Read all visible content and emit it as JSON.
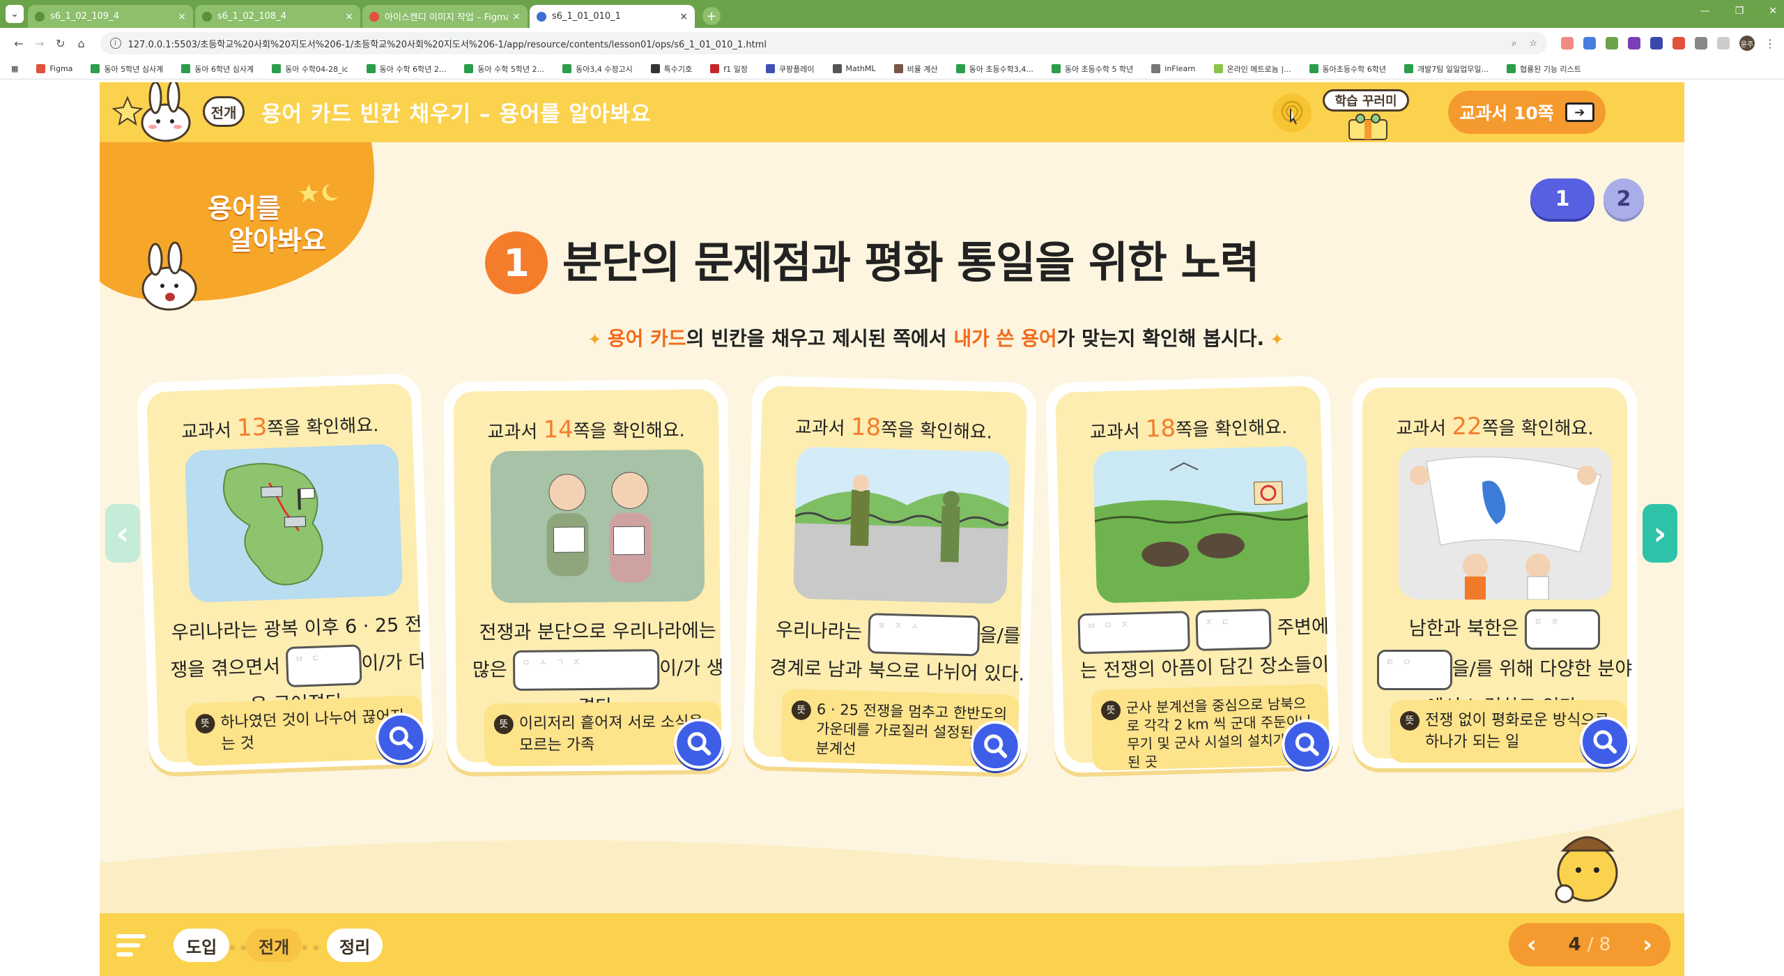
{
  "browser": {
    "tabs": [
      {
        "title": "s6_1_02_109_4",
        "close": "×"
      },
      {
        "title": "s6_1_02_108_4",
        "close": "×"
      },
      {
        "title": "아이스캔디 이미지 작업 – Figma",
        "close": "×"
      },
      {
        "title": "s6_1_01_010_1",
        "close": "×"
      }
    ],
    "new_tab": "+",
    "window_controls": [
      "—",
      "❐",
      "✕"
    ],
    "url": "127.0.0.1:5503/초등학교%20사회%20지도서%206-1/초등학교%20사회%20지도서%206-1/app/resource/contents/lesson01/ops/s6_1_01_010_1.html",
    "profile": "윤주",
    "bookmarks": [
      "Figma",
      "동아 5학년 심사계",
      "동아 6학년 심사계",
      "동아 수학04-28_ic",
      "동아 수학 6학년 2...",
      "동아 수학 5학년 2...",
      "동아3,4 수정고시",
      "특수기호",
      "f1 일정",
      "쿠팡플레이",
      "MathML",
      "비율 계산",
      "동아 초등수학3,4...",
      "동아 초등수학 5 학년",
      "inFlearn",
      "온라인 메트로놈 |...",
      "동아초등수학 6학년",
      "개발7팀 일일업무일...",
      "협룡된 기능 리스트"
    ]
  },
  "header": {
    "stage_badge": "전개",
    "title": "용어 카드 빈칸 채우기 – 용어를 알아봐요",
    "study_label": "학습 꾸러미",
    "book_label": "교과서 10쪽"
  },
  "corner": {
    "line1": "용어를",
    "line2": "알아봐요"
  },
  "pager_dots": [
    "1",
    "2"
  ],
  "section": {
    "number": "1",
    "title": "분단의 문제점과 평화 통일을 위한 노력",
    "instruction": {
      "p1": "용어 카드",
      "p2": "의 빈칸을 채우고 제시된 쪽에서 ",
      "p3": "내가 쓴 용어",
      "p4": "가 맞는지 확인해 봅시다."
    }
  },
  "cards": [
    {
      "head_pre": "교과서 ",
      "page": "13",
      "head_post": "쪽을 확인해요.",
      "t1": "우리나라는 광복 이후 6 · 25 전쟁을 겪으면서",
      "b1": "ㅂㄷ",
      "t2": "이/가 더욱 굳어졌다.",
      "label": "뜻",
      "meaning": "하나였던 것이 나누어 끊어지는 것"
    },
    {
      "head_pre": "교과서 ",
      "page": "14",
      "head_post": "쪽을 확인해요.",
      "t1": "전쟁과 분단으로 우리나라에는 많은",
      "b1": "ㅇㅅㄱㅈ",
      "t2": "이/가 생겼다.",
      "label": "뜻",
      "meaning": "이리저리 흩어져 서로 소식을 모르는 가족"
    },
    {
      "head_pre": "교과서 ",
      "page": "18",
      "head_post": "쪽을 확인해요.",
      "t1": "우리나라는",
      "b1": "ㅎㅈㅅ",
      "t2": "을/를 경계로 남과 북으로 나뉘어 있다.",
      "label": "뜻",
      "meaning": "6 · 25 전쟁을 멈추고 한반도의 가운데를 가로질러 설정된 군사 분계선"
    },
    {
      "head_pre": "교과서 ",
      "page": "18",
      "head_post": "쪽을 확인해요.",
      "b1": "ㅂㅁㅈ",
      "b2": "ㅈㄷ",
      "t1": "주변에는 전쟁의 아픔이 담긴 장소들이 있다.",
      "label": "뜻",
      "meaning": "군사 분계선을 중심으로 남북으로 각각 2 km 씩 군대 주둔이나 무기 및 군사 시설의 설치가 금지된 곳"
    },
    {
      "head_pre": "교과서 ",
      "page": "22",
      "head_post": "쪽을 확인해요.",
      "t1": "남한과 북한은",
      "b1": "ㅍㅎ",
      "b2": "ㅌㅇ",
      "t2": "을/를 위해 다양한 분야에서 노력하고 있다.",
      "label": "뜻",
      "meaning": "전쟁 없이 평화로운 방식으로 하나가 되는 일"
    }
  ],
  "footer": {
    "steps": [
      "도입",
      "전개",
      "정리"
    ],
    "current_page": "4",
    "total_pages": "/ 8"
  },
  "colors": {
    "accent": "#f47d2c",
    "header": "#fbd24e",
    "zoom": "#3f5ee8",
    "card_bg": "#fdedb0"
  }
}
